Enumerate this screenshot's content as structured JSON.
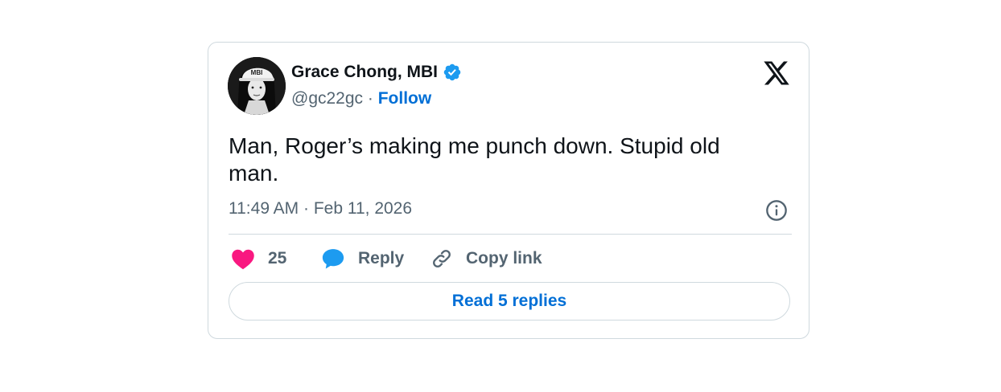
{
  "tweet": {
    "author_name": "Grace Chong, MBI",
    "handle": "@gc22gc",
    "separator": " · ",
    "follow_label": "Follow",
    "text": "Man, Roger’s making me punch down. Stupid old man.",
    "timestamp": "11:49 AM · Feb 11, 2026",
    "avatar_cap_text": "MBI"
  },
  "actions": {
    "like_count": "25",
    "reply_label": "Reply",
    "copy_link_label": "Copy link"
  },
  "read_replies_label": "Read 5 replies",
  "icons": {
    "verified": "verified-badge-icon",
    "brand": "x-logo-icon",
    "info": "info-icon",
    "like": "heart-icon",
    "reply": "speech-bubble-icon",
    "copy": "link-icon"
  },
  "colors": {
    "accent": "#006fd6",
    "verified": "#1d9bf0",
    "like": "#f91880",
    "reply_icon": "#1d9bf0",
    "muted_text": "#536471",
    "border": "#cfd9de"
  }
}
